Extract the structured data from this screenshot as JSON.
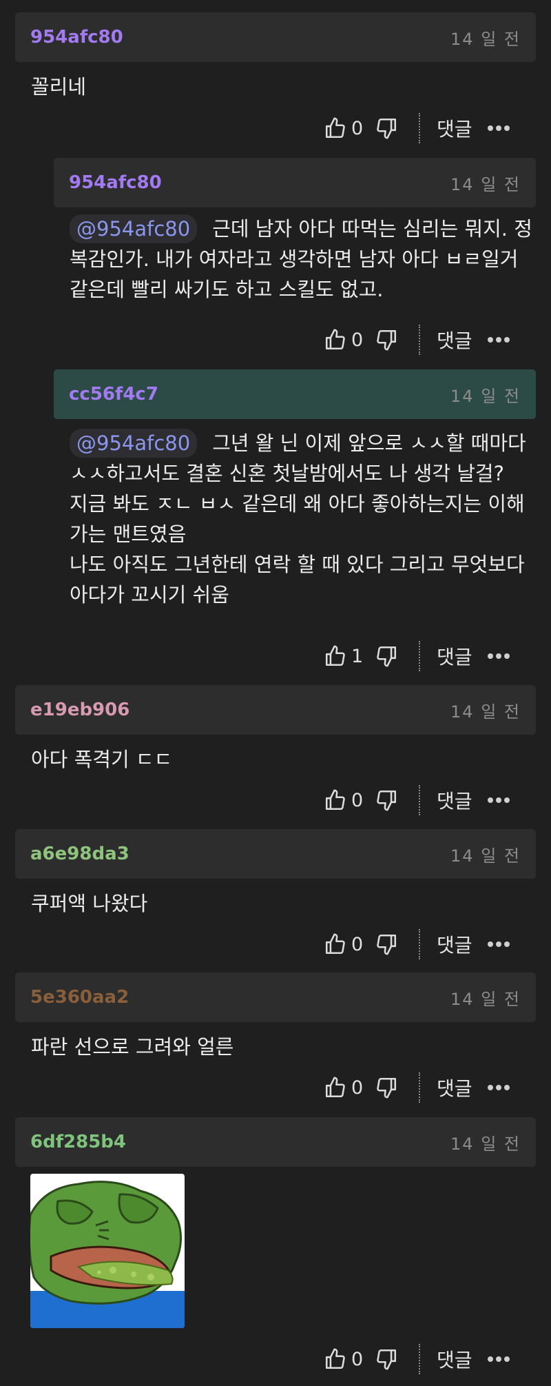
{
  "ui": {
    "reply_label": "댓글",
    "like_icon": "thumbs-up-icon",
    "dislike_icon": "thumbs-down-icon",
    "more_icon": "more-dots-icon"
  },
  "comments": [
    {
      "author": "954afc80",
      "author_color": "#a27bf2",
      "date": "14 일 전",
      "text": "꼴리네",
      "likes": "0"
    },
    {
      "author": "954afc80",
      "author_color": "#a27bf2",
      "date": "14 일 전",
      "mention": "@954afc80",
      "text": "근데 남자 아다 따먹는 심리는 뭐지. 정복감인가. 내가 여자라고 생각하면 남자 아다 ㅂㄹ일거 같은데 빨리 싸기도 하고 스킬도 없고.",
      "likes": "0"
    },
    {
      "author": "cc56f4c7",
      "author_color": "#a27bf2",
      "date": "14 일 전",
      "mention": "@954afc80",
      "text_lines": [
        "그년 왈 닌 이제 앞으로 ㅅㅅ할 때마다",
        "ㅅㅅ하고서도 결혼 신혼 첫날밤에서도 나 생각 날걸?",
        "지금 봐도 ㅈㄴ ㅂㅅ 같은데 왜 아다 좋아하는지는 이해",
        "가는 맨트였음",
        "나도 아직도 그년한테 연락 할 때 있다 그리고 무엇보다",
        "아다가 꼬시기 쉬움"
      ],
      "likes": "1"
    },
    {
      "author": "e19eb906",
      "author_color": "#d79ab0",
      "date": "14 일 전",
      "text": "아다 폭격기 ㄷㄷ",
      "likes": "0"
    },
    {
      "author": "a6e98da3",
      "author_color": "#8fc47d",
      "date": "14 일 전",
      "text": "쿠퍼액 나왔다",
      "likes": "0"
    },
    {
      "author": "5e360aa2",
      "author_color": "#8a5f3a",
      "date": "14 일 전",
      "text": "파란 선으로 그려와 얼른",
      "likes": "0"
    },
    {
      "author": "6df285b4",
      "author_color": "#7fc47c",
      "date": "14 일 전",
      "image": "pepe-vomit-image",
      "likes": "0"
    }
  ]
}
